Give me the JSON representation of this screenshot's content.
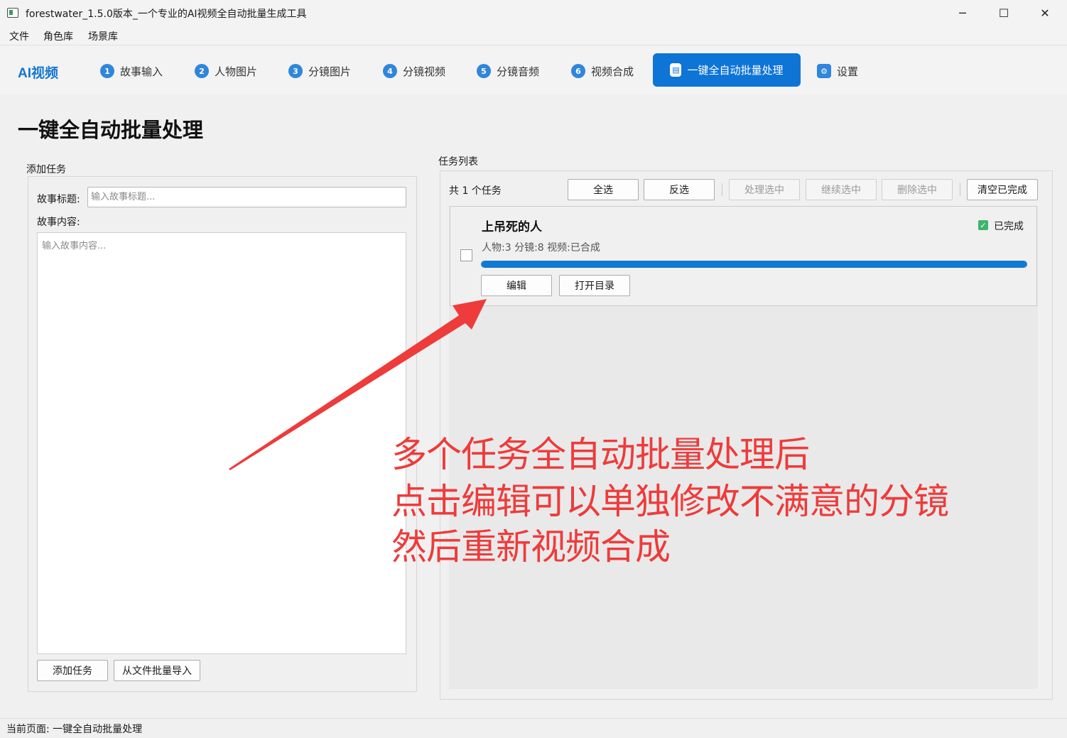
{
  "window": {
    "title": "forestwater_1.5.0版本_一个专业的AI视频全自动批量生成工具",
    "min_icon": "─",
    "max_icon": "☐",
    "close_icon": "✕"
  },
  "menu": [
    "文件",
    "角色库",
    "场景库"
  ],
  "nav": {
    "brand": "AI视频",
    "tabs": [
      {
        "num": "1",
        "label": "故事输入"
      },
      {
        "num": "2",
        "label": "人物图片"
      },
      {
        "num": "3",
        "label": "分镜图片"
      },
      {
        "num": "4",
        "label": "分镜视频"
      },
      {
        "num": "5",
        "label": "分镜音频"
      },
      {
        "num": "6",
        "label": "视频合成"
      },
      {
        "num": "▤",
        "label": "一键全自动批量处理"
      },
      {
        "num": "⚙",
        "label": "设置"
      }
    ],
    "active_color": "#0e74d6"
  },
  "page": {
    "title": "一键全自动批量处理"
  },
  "add_task": {
    "section_label": "添加任务",
    "title_label": "故事标题:",
    "title_placeholder": "输入故事标题...",
    "content_label": "故事内容:",
    "content_placeholder": "输入故事内容...",
    "add_button": "添加任务",
    "import_button": "从文件批量导入"
  },
  "task_list": {
    "section_label": "任务列表",
    "count_text": "共 1 个任务",
    "buttons": {
      "select_all": "全选",
      "invert": "反选",
      "process_selected": "处理选中",
      "continue_selected": "继续选中",
      "delete_selected": "删除选中",
      "clear_completed": "清空已完成"
    },
    "tasks": [
      {
        "name": "上吊死的人",
        "meta": "人物:3  分镜:8  视频:已合成",
        "status": "已完成",
        "progress": 1.0,
        "edit_button": "编辑",
        "open_dir_button": "打开目录"
      }
    ]
  },
  "annotation": {
    "lines": [
      "多个任务全自动批量处理后",
      "点击编辑可以单独修改不满意的分镜",
      "然后重新视频合成"
    ],
    "color": "#ee3b3b"
  },
  "statusbar": {
    "text": "当前页面: 一键全自动批量处理"
  }
}
